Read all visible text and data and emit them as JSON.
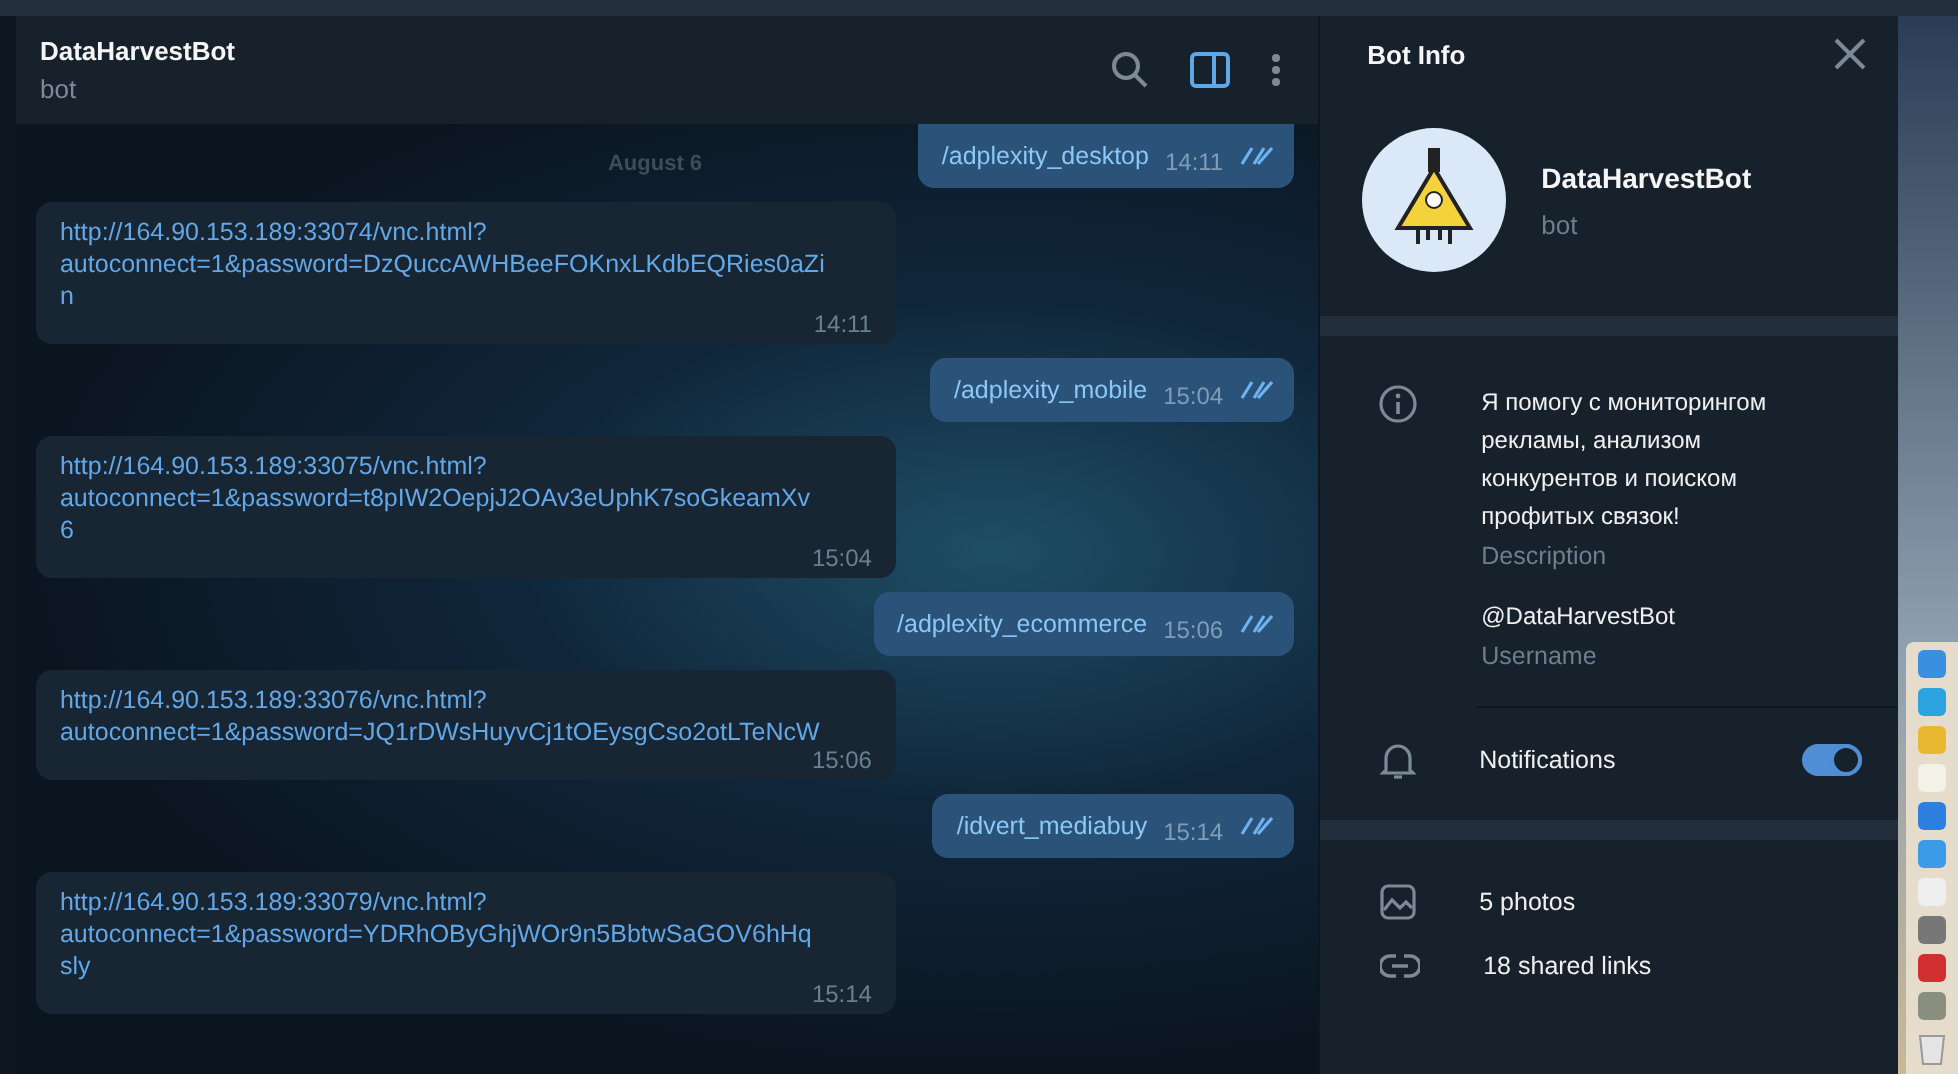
{
  "header": {
    "title": "DataHarvestBot",
    "subtitle": "bot"
  },
  "date_label": "August 6",
  "messages": [
    {
      "kind": "outgoing",
      "text": "/adplexity_desktop",
      "time": "14:11",
      "read": true
    },
    {
      "kind": "incoming",
      "text": "http://164.90.153.189:33074/vnc.html?\nautoconnect=1&password=DzQuccAWHBeeFOKnxLKdbEQRies0aZi\nn",
      "time": "14:11"
    },
    {
      "kind": "outgoing",
      "text": "/adplexity_mobile",
      "time": "15:04",
      "read": true
    },
    {
      "kind": "incoming",
      "text": "http://164.90.153.189:33075/vnc.html?\nautoconnect=1&password=t8pIW2OepjJ2OAv3eUphK7soGkeamXv\n6",
      "time": "15:04"
    },
    {
      "kind": "outgoing",
      "text": "/adplexity_ecommerce",
      "time": "15:06",
      "read": true
    },
    {
      "kind": "incoming",
      "text": "http://164.90.153.189:33076/vnc.html?\nautoconnect=1&password=JQ1rDWsHuyvCj1tOEysgCso2otLTeNcW",
      "time": "15:06"
    },
    {
      "kind": "outgoing",
      "text": "/idvert_mediabuy",
      "time": "15:14",
      "read": true
    },
    {
      "kind": "incoming",
      "text": "http://164.90.153.189:33079/vnc.html?\nautoconnect=1&password=YDRhOByGhjWOr9n5BbtwSaGOV6hHq\nsly",
      "time": "15:14"
    }
  ],
  "info_panel": {
    "title": "Bot Info",
    "name": "DataHarvestBot",
    "subtitle": "bot",
    "description": "Я помогу с мониторингом рекламы, анализом конкурентов и поиском профитых связок!",
    "description_label": "Description",
    "username": "@DataHarvestBot",
    "username_label": "Username",
    "notifications": {
      "label": "Notifications",
      "on": true
    },
    "media": [
      {
        "kind": "photos",
        "label": "5 photos"
      },
      {
        "kind": "links",
        "label": "18 shared links"
      }
    ]
  }
}
